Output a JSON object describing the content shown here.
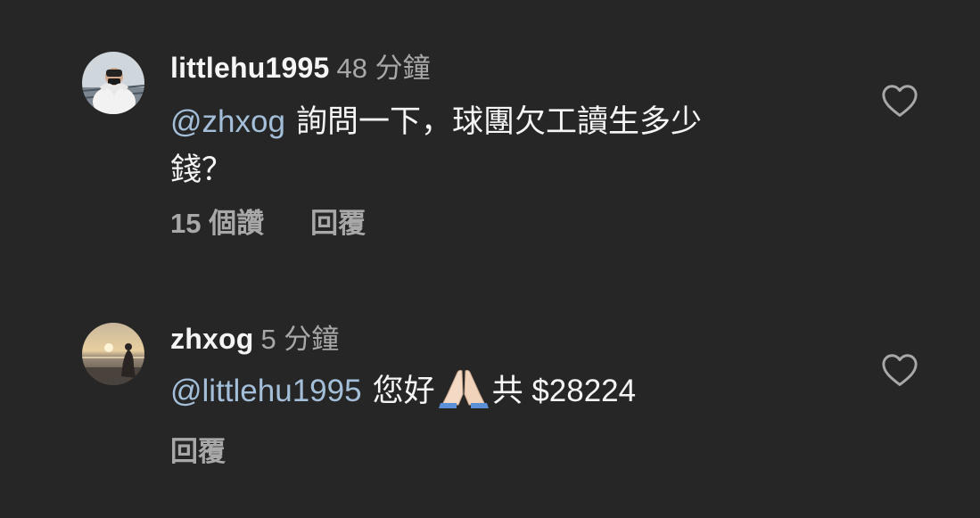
{
  "comments": [
    {
      "username": "littlehu1995",
      "time": "48 分鐘",
      "mention": "@zhxog",
      "text_line1": "詢問一下，球團欠工讀生多少",
      "text_line2": "錢？",
      "likes": "15 個讚",
      "reply_label": "回覆",
      "avatar_icon": "avatar-person-hoodie",
      "like_icon": "heart-outline-icon"
    },
    {
      "username": "zhxog",
      "time": "5 分鐘",
      "mention": "@littlehu1995",
      "text_before_emoji": "您好",
      "emoji": "folded-hands-emoji",
      "text_after_emoji": "共 $28224",
      "reply_label": "回覆",
      "avatar_icon": "avatar-beach-sunset",
      "like_icon": "heart-outline-icon"
    }
  ],
  "colors": {
    "background": "#262626",
    "primary_text": "#f5f5f5",
    "secondary_text": "#a8a8a8",
    "mention": "#a4bfd9"
  }
}
